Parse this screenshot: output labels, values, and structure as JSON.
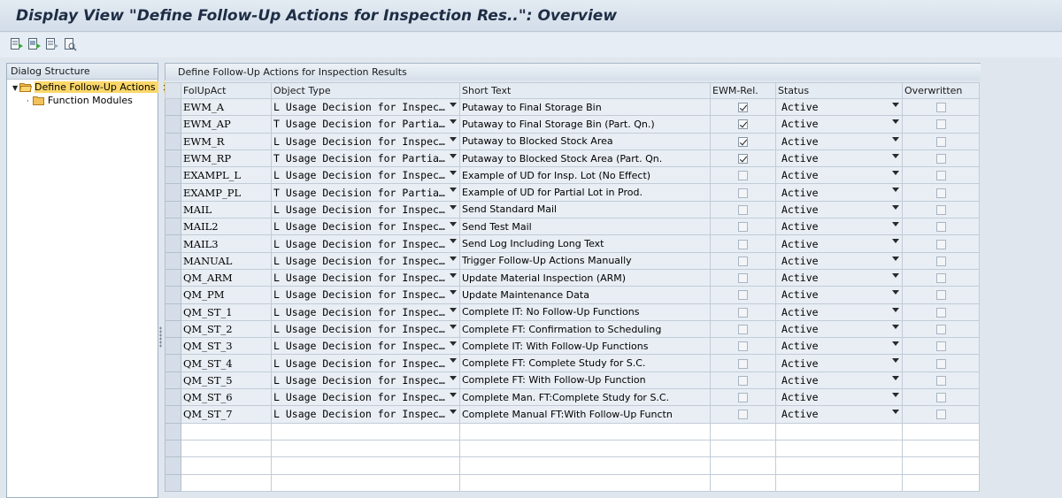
{
  "window": {
    "title": "Display View \"Define Follow-Up Actions for Inspection Res..\": Overview"
  },
  "toolbar": {
    "buttons": [
      {
        "name": "select-all-icon"
      },
      {
        "name": "select-block-icon"
      },
      {
        "name": "deselect-all-icon"
      },
      {
        "name": "print-icon"
      }
    ]
  },
  "dialog_structure": {
    "header": "Dialog Structure",
    "items": [
      {
        "label": "Define Follow-Up Actions for",
        "level": 0,
        "selected": true,
        "expanded": true
      },
      {
        "label": "Function Modules",
        "level": 1,
        "selected": false,
        "expanded": false
      }
    ]
  },
  "panel": {
    "title": "Define Follow-Up Actions for Inspection Results"
  },
  "table": {
    "columns": {
      "folupact": "FolUpAct",
      "object_type": "Object Type",
      "short_text": "Short Text",
      "ewm_rel": "EWM-Rel.",
      "status": "Status",
      "overwritten": "Overwritten"
    },
    "rows": [
      {
        "key": "EWM_A",
        "object_type": "L Usage Decision for Inspec…",
        "short_text": "Putaway to Final Storage Bin",
        "ewm": true,
        "status": "Active",
        "overwritten": false
      },
      {
        "key": "EWM_AP",
        "object_type": "T Usage Decision for Partia…",
        "short_text": "Putaway to Final Storage Bin (Part. Qn.)",
        "ewm": true,
        "status": "Active",
        "overwritten": false
      },
      {
        "key": "EWM_R",
        "object_type": "L Usage Decision for Inspec…",
        "short_text": "Putaway to Blocked Stock Area",
        "ewm": true,
        "status": "Active",
        "overwritten": false
      },
      {
        "key": "EWM_RP",
        "object_type": "T Usage Decision for Partia…",
        "short_text": "Putaway to Blocked Stock Area (Part. Qn.",
        "ewm": true,
        "status": "Active",
        "overwritten": false
      },
      {
        "key": "EXAMPL_L",
        "object_type": "L Usage Decision for Inspec…",
        "short_text": "Example of UD for Insp. Lot (No Effect)",
        "ewm": false,
        "status": "Active",
        "overwritten": false
      },
      {
        "key": "EXAMP_PL",
        "object_type": "T Usage Decision for Partia…",
        "short_text": "Example of UD for Partial Lot in Prod.",
        "ewm": false,
        "status": "Active",
        "overwritten": false
      },
      {
        "key": "MAIL",
        "object_type": "L Usage Decision for Inspec…",
        "short_text": "Send Standard Mail",
        "ewm": false,
        "status": "Active",
        "overwritten": false
      },
      {
        "key": "MAIL2",
        "object_type": "L Usage Decision for Inspec…",
        "short_text": "Send Test Mail",
        "ewm": false,
        "status": "Active",
        "overwritten": false
      },
      {
        "key": "MAIL3",
        "object_type": "L Usage Decision for Inspec…",
        "short_text": "Send Log Including Long Text",
        "ewm": false,
        "status": "Active",
        "overwritten": false
      },
      {
        "key": "MANUAL",
        "object_type": "L Usage Decision for Inspec…",
        "short_text": "Trigger Follow-Up Actions Manually",
        "ewm": false,
        "status": "Active",
        "overwritten": false
      },
      {
        "key": "QM_ARM",
        "object_type": "L Usage Decision for Inspec…",
        "short_text": "Update Material Inspection (ARM)",
        "ewm": false,
        "status": "Active",
        "overwritten": false
      },
      {
        "key": "QM_PM",
        "object_type": "L Usage Decision for Inspec…",
        "short_text": "Update Maintenance Data",
        "ewm": false,
        "status": "Active",
        "overwritten": false
      },
      {
        "key": "QM_ST_1",
        "object_type": "L Usage Decision for Inspec…",
        "short_text": "Complete IT: No Follow-Up Functions",
        "ewm": false,
        "status": "Active",
        "overwritten": false
      },
      {
        "key": "QM_ST_2",
        "object_type": "L Usage Decision for Inspec…",
        "short_text": "Complete FT: Confirmation to Scheduling",
        "ewm": false,
        "status": "Active",
        "overwritten": false
      },
      {
        "key": "QM_ST_3",
        "object_type": "L Usage Decision for Inspec…",
        "short_text": "Complete IT: With Follow-Up Functions",
        "ewm": false,
        "status": "Active",
        "overwritten": false
      },
      {
        "key": "QM_ST_4",
        "object_type": "L Usage Decision for Inspec…",
        "short_text": "Complete FT: Complete Study for S.C.",
        "ewm": false,
        "status": "Active",
        "overwritten": false
      },
      {
        "key": "QM_ST_5",
        "object_type": "L Usage Decision for Inspec…",
        "short_text": "Complete FT: With Follow-Up Function",
        "ewm": false,
        "status": "Active",
        "overwritten": false
      },
      {
        "key": "QM_ST_6",
        "object_type": "L Usage Decision for Inspec…",
        "short_text": "Complete Man. FT:Complete Study for S.C.",
        "ewm": false,
        "status": "Active",
        "overwritten": false
      },
      {
        "key": "QM_ST_7",
        "object_type": "L Usage Decision for Inspec…",
        "short_text": "Complete Manual FT:With Follow-Up Functn",
        "ewm": false,
        "status": "Active",
        "overwritten": false
      }
    ],
    "empty_rows": 4
  },
  "colors": {
    "selected_folder_bg": "#fbd769",
    "title_text": "#1e2d45"
  }
}
